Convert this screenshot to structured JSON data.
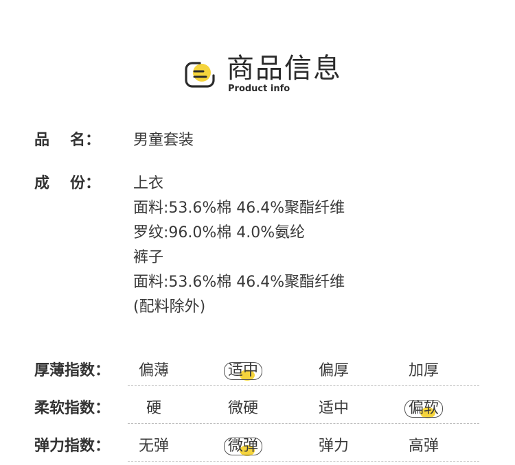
{
  "header": {
    "title": "商品信息",
    "subtitle": "Product info",
    "icon": "document-lines-icon",
    "accent_color": "#f5d43c"
  },
  "product_name": {
    "label_a": "品",
    "label_b": "名：",
    "value": "男童套装"
  },
  "composition": {
    "label_a": "成",
    "label_b": "份：",
    "lines": [
      "上衣",
      "面料:53.6%棉 46.4%聚酯纤维",
      "罗纹:96.0%棉 4.0%氨纶",
      "裤子",
      "面料:53.6%棉 46.4%聚酯纤维",
      "(配料除外)"
    ]
  },
  "indices": [
    {
      "label": "厚薄指数：",
      "options": [
        "偏薄",
        "适中",
        "偏厚",
        "加厚"
      ],
      "selected": 1
    },
    {
      "label": "柔软指数：",
      "options": [
        "硬",
        "微硬",
        "适中",
        "偏软"
      ],
      "selected": 3
    },
    {
      "label": "弹力指数：",
      "options": [
        "无弹",
        "微弹",
        "弹力",
        "高弹"
      ],
      "selected": 1
    }
  ]
}
